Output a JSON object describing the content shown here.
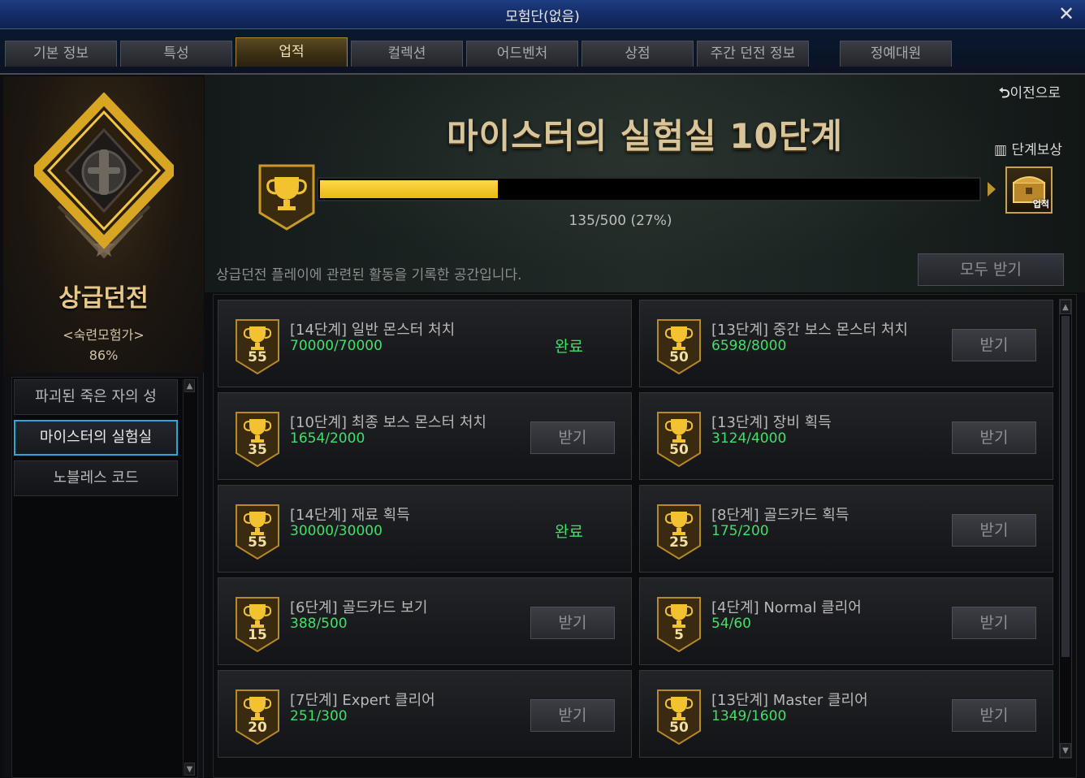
{
  "window": {
    "title": "모험단(없음)",
    "close": "✕"
  },
  "tabs": [
    "기본 정보",
    "특성",
    "업적",
    "컬렉션",
    "어드벤처",
    "상점",
    "주간 던전 정보",
    "정예대원"
  ],
  "active_tab": "업적",
  "left": {
    "category": "상급던전",
    "rank": "<숙련모험가>",
    "percent": "86%",
    "items": [
      "파괴된 죽은 자의 성",
      "마이스터의 실험실",
      "노블레스 코드"
    ],
    "active_item": "마이스터의 실험실"
  },
  "header": {
    "back": "이전으로",
    "title": "마이스터의 실험실 10단계",
    "stage_reward": "단계보상",
    "progress_text": "135/500 (27%)",
    "progress_fraction": 0.27,
    "reward_icon_label": "업적",
    "description": "상급던전 플레이에 관련된 활동을 기록한 공간입니다.",
    "claim_all": "모두 받기"
  },
  "achievements": [
    {
      "points": "55",
      "name": "[14단계] 일반 몬스터 처치",
      "progress": "70000/70000",
      "state": "완료"
    },
    {
      "points": "50",
      "name": "[13단계] 중간 보스 몬스터 처치",
      "progress": "6598/8000",
      "state": "받기"
    },
    {
      "points": "35",
      "name": "[10단계] 최종 보스 몬스터 처치",
      "progress": "1654/2000",
      "state": "받기"
    },
    {
      "points": "50",
      "name": "[13단계] 장비 획득",
      "progress": "3124/4000",
      "state": "받기"
    },
    {
      "points": "55",
      "name": "[14단계] 재료 획득",
      "progress": "30000/30000",
      "state": "완료"
    },
    {
      "points": "25",
      "name": "[8단계] 골드카드 획득",
      "progress": "175/200",
      "state": "받기"
    },
    {
      "points": "15",
      "name": "[6단계] 골드카드 보기",
      "progress": "388/500",
      "state": "받기"
    },
    {
      "points": "5",
      "name": "[4단계] Normal 클리어",
      "progress": "54/60",
      "state": "받기"
    },
    {
      "points": "20",
      "name": "[7단계] Expert 클리어",
      "progress": "251/300",
      "state": "받기"
    },
    {
      "points": "50",
      "name": "[13단계] Master 클리어",
      "progress": "1349/1600",
      "state": "받기"
    }
  ],
  "colors": {
    "accent_gold": "#e9b812",
    "complete_green": "#3fe06a",
    "active_blue": "#2fa4d8"
  },
  "icons": [
    "trophy-icon",
    "close-icon",
    "back-arrow-icon",
    "gift-icon",
    "reward-chest-icon",
    "emblem-icon"
  ]
}
